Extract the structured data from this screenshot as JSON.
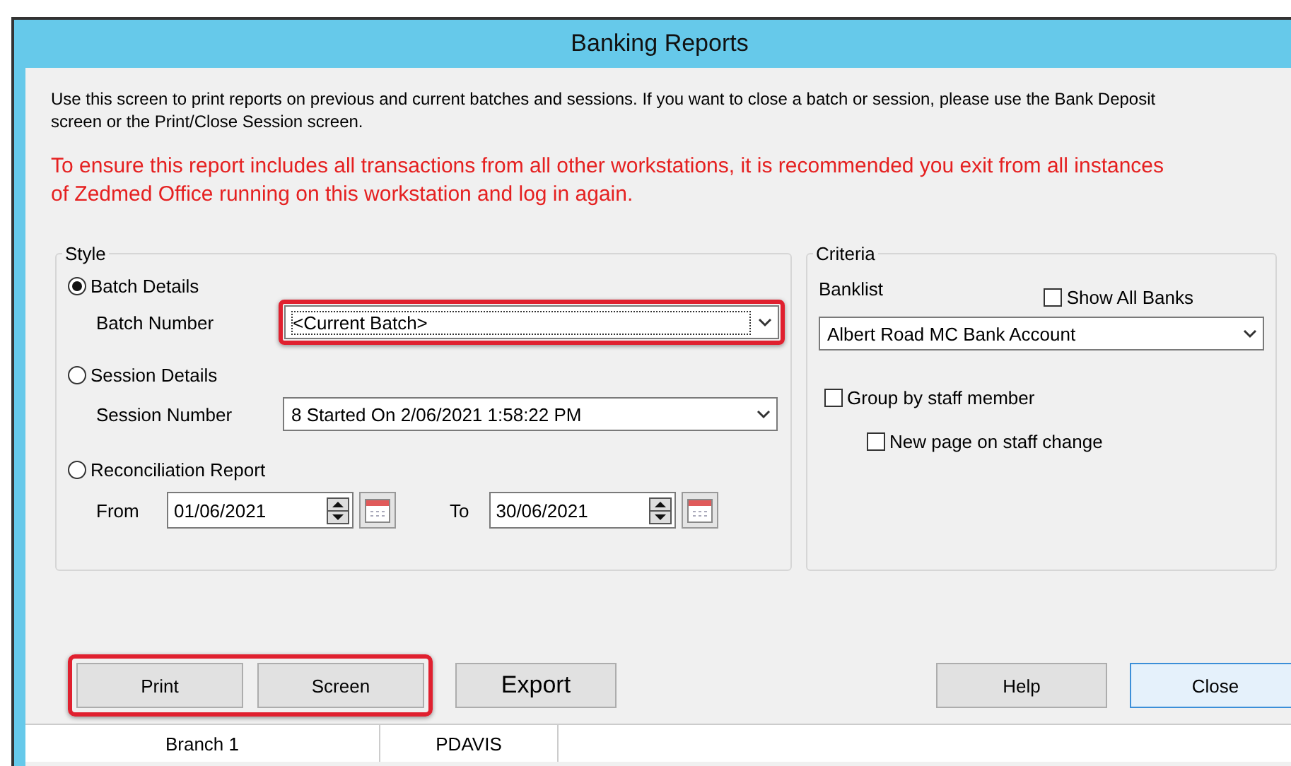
{
  "window": {
    "title": "Banking Reports"
  },
  "intro": "Use this screen to print reports on previous and current batches and sessions.  If you want to close a batch or session, please use the Bank Deposit screen or the Print/Close Session screen.",
  "warning": "To ensure this report includes all transactions from all other workstations, it is recommended you exit from all instances of Zedmed Office running on this workstation and log in again.",
  "style": {
    "legend": "Style",
    "options": [
      {
        "kind": "combo",
        "label": "Batch Details",
        "selected": true,
        "field_label": "Batch Number",
        "value": "<Current Batch>",
        "highlighted": true
      },
      {
        "kind": "combo",
        "label": "Session Details",
        "selected": false,
        "field_label": "Session Number",
        "value": "8 Started On 2/06/2021 1:58:22 PM",
        "highlighted": false
      },
      {
        "kind": "range",
        "label": "Reconciliation Report",
        "selected": false,
        "from_label": "From",
        "from": "01/06/2021",
        "to_label": "To",
        "to": "30/06/2021"
      }
    ]
  },
  "criteria": {
    "legend": "Criteria",
    "banklist_label": "Banklist",
    "show_all": {
      "label": "Show All Banks",
      "checked": false
    },
    "bank": "Albert Road MC Bank Account",
    "options": [
      {
        "label": "Group by staff member",
        "checked": false,
        "children": [
          {
            "label": "New page on staff change",
            "checked": false
          }
        ]
      }
    ]
  },
  "left_button_groups": [
    {
      "highlighted": true,
      "buttons": [
        {
          "label": "Print",
          "default": false
        },
        {
          "label": "Screen",
          "default": false
        }
      ]
    },
    {
      "highlighted": false,
      "buttons": [
        {
          "label": "Export",
          "default": false
        }
      ]
    }
  ],
  "right_buttons": [
    {
      "label": "Help",
      "default": false
    },
    {
      "label": "Close",
      "default": true
    }
  ],
  "status_bar": [
    "Branch 1",
    "PDAVIS"
  ]
}
